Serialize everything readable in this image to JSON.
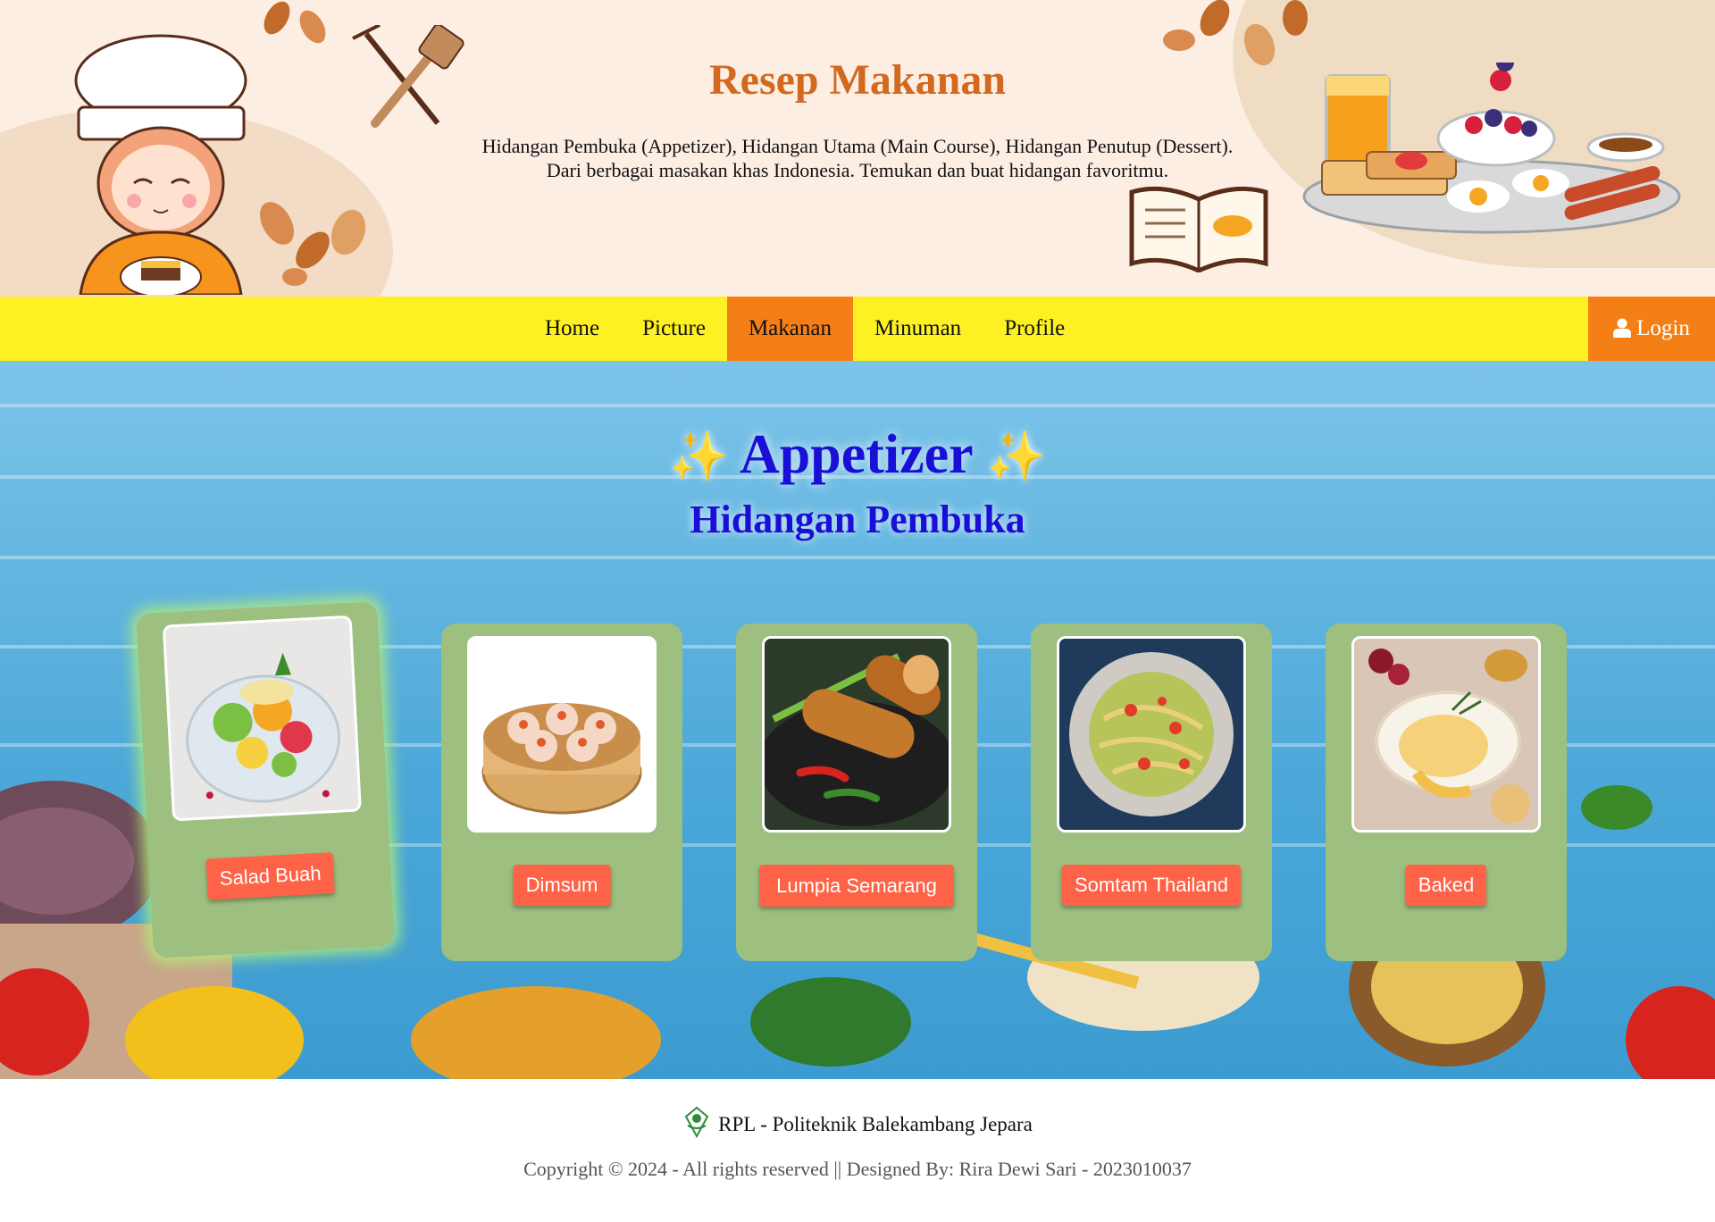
{
  "header": {
    "title": "Resep Makanan",
    "description_line1": "Hidangan Pembuka (Appetizer), Hidangan Utama (Main Course), Hidangan Penutup (Dessert).",
    "description_line2": "Dari berbagai masakan khas Indonesia. Temukan dan buat hidangan favoritmu."
  },
  "nav": {
    "items": [
      {
        "label": "Home",
        "active": false
      },
      {
        "label": "Picture",
        "active": false
      },
      {
        "label": "Makanan",
        "active": true
      },
      {
        "label": "Minuman",
        "active": false
      },
      {
        "label": "Profile",
        "active": false
      }
    ],
    "login_label": "Login",
    "login_icon": "user-icon"
  },
  "section": {
    "title": "Appetizer",
    "sparkle": "✨",
    "subtitle": "Hidangan Pembuka"
  },
  "cards": [
    {
      "label": "Salad Buah",
      "image": "fruit-salad-image"
    },
    {
      "label": "Dimsum",
      "image": "dimsum-image"
    },
    {
      "label": "Lumpia Semarang",
      "image": "spring-roll-image"
    },
    {
      "label": "Somtam Thailand",
      "image": "papaya-salad-image"
    },
    {
      "label": "Baked",
      "image": "baked-brie-image"
    }
  ],
  "footer": {
    "org": "RPL - Politeknik Balekambang Jepara",
    "copyright": "Copyright © 2024 - All rights reserved || Designed By: Rira Dewi Sari - 2023010037"
  },
  "colors": {
    "nav_bg": "#fdf124",
    "nav_active": "#f57f17",
    "title_orange": "#d2691e",
    "heading_blue": "#1a0fd6",
    "card_bg": "#9dbf7f",
    "card_button": "#ff6347"
  }
}
